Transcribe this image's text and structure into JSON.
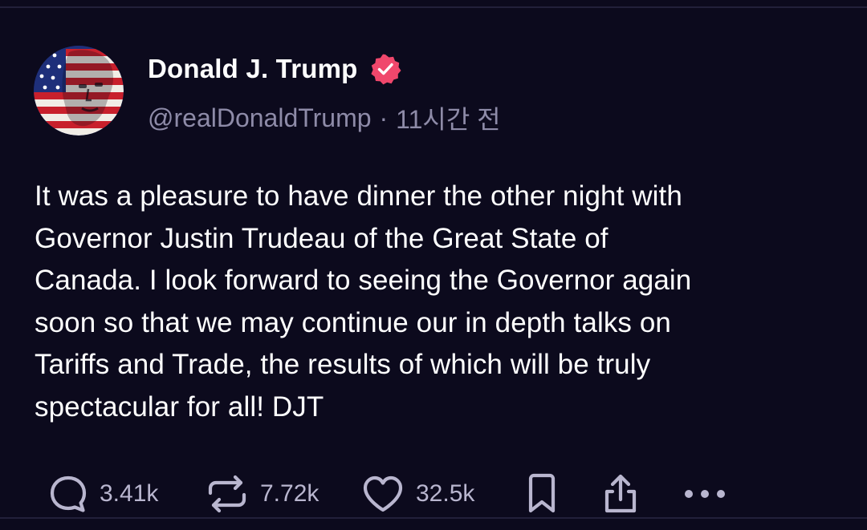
{
  "post": {
    "author": {
      "display_name": "Donald J. Trump",
      "handle": "@realDonaldTrump",
      "verified": true,
      "avatar_icon": "flag-portrait-avatar"
    },
    "separator": "·",
    "timestamp": "11시간 전",
    "body": "It was a pleasure to have dinner the other night with\nGovernor Justin Trudeau of the Great State of\nCanada. I look forward to seeing the Governor again\nsoon so that we may continue our in depth talks on\nTariffs and Trade, the results of which will be truly\nspectacular for all! DJT",
    "actions": {
      "replies": "3.41k",
      "reposts": "7.72k",
      "likes": "32.5k"
    }
  },
  "colors": {
    "background": "#0c0a1d",
    "text": "#ffffff",
    "muted": "#8e8ba8",
    "action": "#b9b6cf",
    "verified": "#f0476c"
  }
}
